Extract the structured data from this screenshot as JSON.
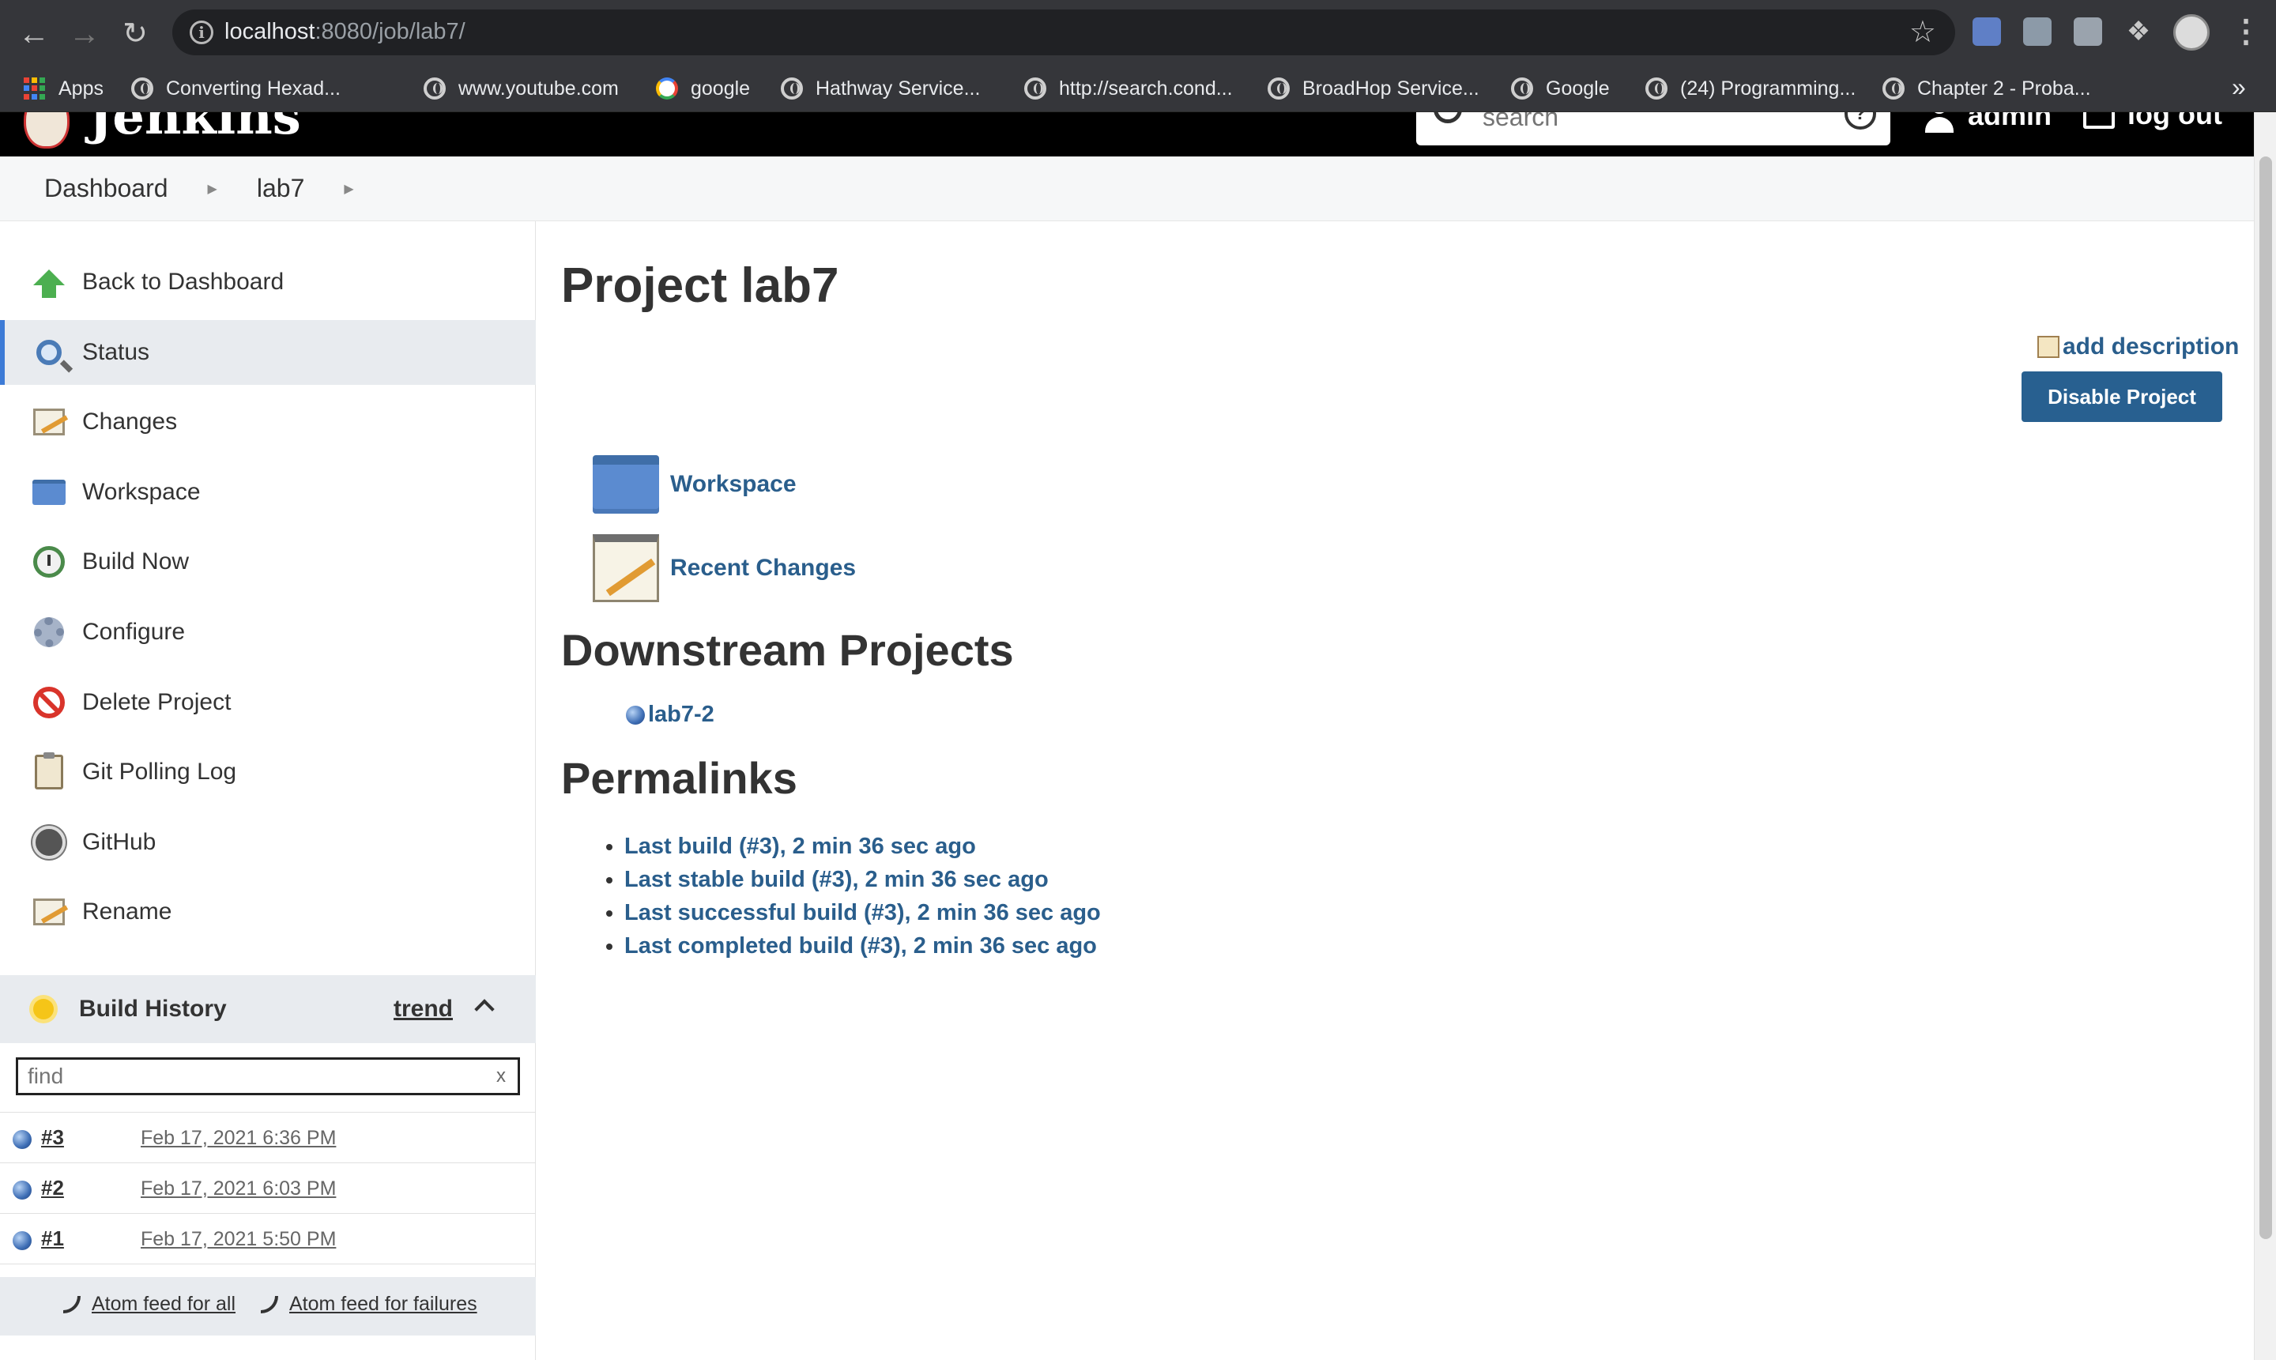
{
  "browser": {
    "url_host": "localhost",
    "url_rest": ":8080/job/lab7/",
    "bookmarks": [
      {
        "label": "Apps",
        "icon": "apps-grid-icon"
      },
      {
        "label": "Converting Hexad...",
        "icon": "globe-icon"
      },
      {
        "label": "www.youtube.com",
        "icon": "globe-icon"
      },
      {
        "label": "google",
        "icon": "google-icon"
      },
      {
        "label": "Hathway Service...",
        "icon": "globe-icon"
      },
      {
        "label": "http://search.cond...",
        "icon": "globe-icon"
      },
      {
        "label": "BroadHop Service...",
        "icon": "globe-icon"
      },
      {
        "label": "Google",
        "icon": "globe-icon"
      },
      {
        "label": "(24) Programming...",
        "icon": "globe-icon"
      },
      {
        "label": "Chapter 2 - Proba...",
        "icon": "globe-icon"
      }
    ],
    "more_label": "»"
  },
  "header": {
    "brand": "Jenkins",
    "search_placeholder": "search",
    "user": "admin",
    "logout": "log out"
  },
  "breadcrumb": [
    {
      "label": "Dashboard"
    },
    {
      "label": "lab7"
    }
  ],
  "sidebar": {
    "tasks": [
      {
        "label": "Back to Dashboard",
        "icon": "up-arrow-icon"
      },
      {
        "label": "Status",
        "icon": "magnifier-icon",
        "active": true
      },
      {
        "label": "Changes",
        "icon": "notepad-icon"
      },
      {
        "label": "Workspace",
        "icon": "folder-icon"
      },
      {
        "label": "Build Now",
        "icon": "clock-icon"
      },
      {
        "label": "Configure",
        "icon": "gear-icon"
      },
      {
        "label": "Delete Project",
        "icon": "forbidden-icon"
      },
      {
        "label": "Git Polling Log",
        "icon": "clipboard-icon"
      },
      {
        "label": "GitHub",
        "icon": "github-icon"
      },
      {
        "label": "Rename",
        "icon": "notepad-icon"
      }
    ]
  },
  "build_history": {
    "title": "Build History",
    "trend": "trend",
    "filter_placeholder": "find",
    "filter_clear": "x",
    "builds": [
      {
        "number": "#3",
        "date": "Feb 17, 2021 6:36 PM"
      },
      {
        "number": "#2",
        "date": "Feb 17, 2021 6:03 PM"
      },
      {
        "number": "#1",
        "date": "Feb 17, 2021 5:50 PM"
      }
    ],
    "feed_all": "Atom feed for all",
    "feed_failures": "Atom feed for failures"
  },
  "main": {
    "title": "Project lab7",
    "add_description": "add description",
    "disable_button": "Disable Project",
    "workspace_link": "Workspace",
    "recent_changes_link": "Recent Changes",
    "downstream_heading": "Downstream Projects",
    "downstream_projects": [
      "lab7-2"
    ],
    "permalinks_heading": "Permalinks",
    "permalinks": [
      "Last build (#3), 2 min 36 sec ago",
      "Last stable build (#3), 2 min 36 sec ago",
      "Last successful build (#3), 2 min 36 sec ago",
      "Last completed build (#3), 2 min 36 sec ago"
    ]
  },
  "colors": {
    "link": "#2a5e8c",
    "button": "#286090",
    "active_accent": "#3d7bd6",
    "header_bg": "#000000"
  }
}
